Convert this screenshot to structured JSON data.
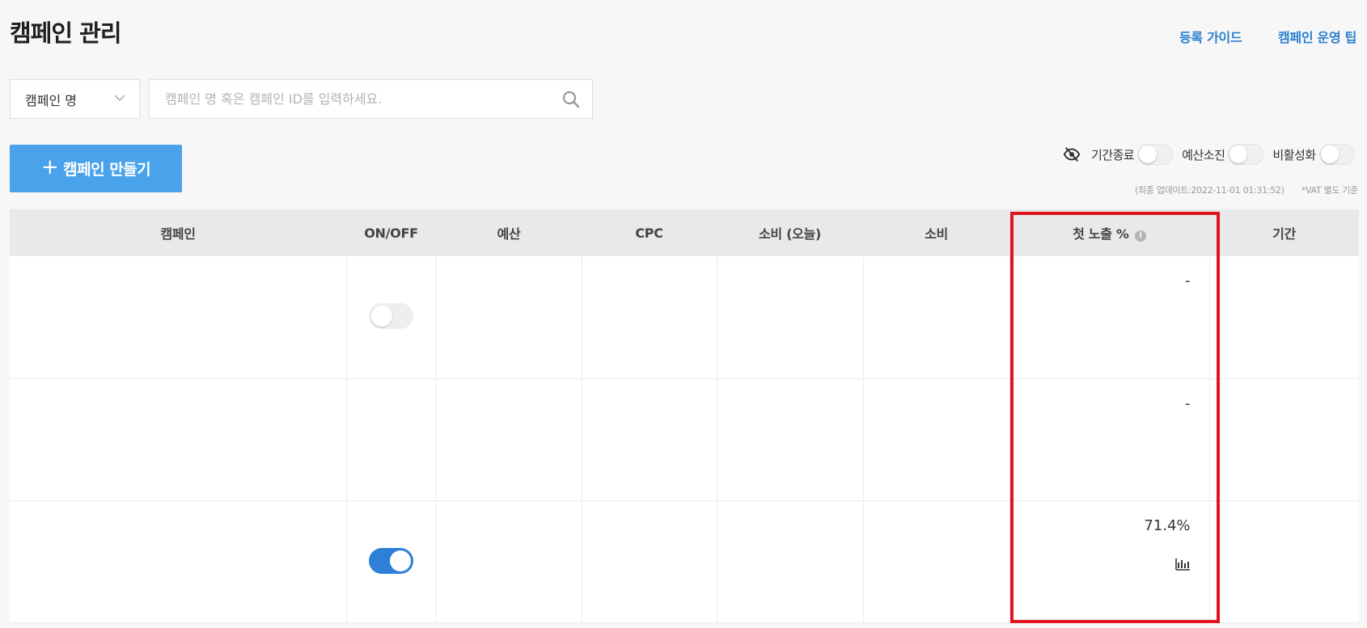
{
  "page": {
    "title": "캠페인 관리",
    "links": {
      "guide": "등록 가이드",
      "tips": "캠페인 운영 팁"
    }
  },
  "search": {
    "filter_selected": "캠페인 명",
    "placeholder": "캠페인 명 혹은 캠페인 ID를 입력하세요.",
    "value": ""
  },
  "actions": {
    "create_plus": "+",
    "create_label": "캠페인 만들기"
  },
  "filters": {
    "period_ended": "기간종료",
    "budget_exhausted": "예산소진",
    "inactive": "비활성화"
  },
  "update_note": {
    "last_update": "(최종 업데이트:2022-11-01 01:31:52)",
    "vat": "*VAT 별도 기준"
  },
  "table": {
    "columns": {
      "campaign": "캠페인",
      "onoff": "ON/OFF",
      "budget": "예산",
      "cpc": "CPC",
      "spend_today": "소비 (오늘)",
      "spend": "소비",
      "first_exposure": "첫 노출 %",
      "period": "기간"
    },
    "info_glyph": "i",
    "rows": [
      {
        "toggle": "off",
        "first_exposure": "-"
      },
      {
        "toggle": "none",
        "first_exposure": "-"
      },
      {
        "toggle": "on",
        "first_exposure": "71.4%"
      }
    ]
  },
  "colors": {
    "accent": "#2d7fd8",
    "create_button": "#4aa3ea",
    "link": "#2a7fcf",
    "highlight": "#e0141e"
  },
  "icons": [
    "chevron-down-icon",
    "search-icon",
    "eye-off-icon",
    "info-icon",
    "bar-chart-icon"
  ]
}
